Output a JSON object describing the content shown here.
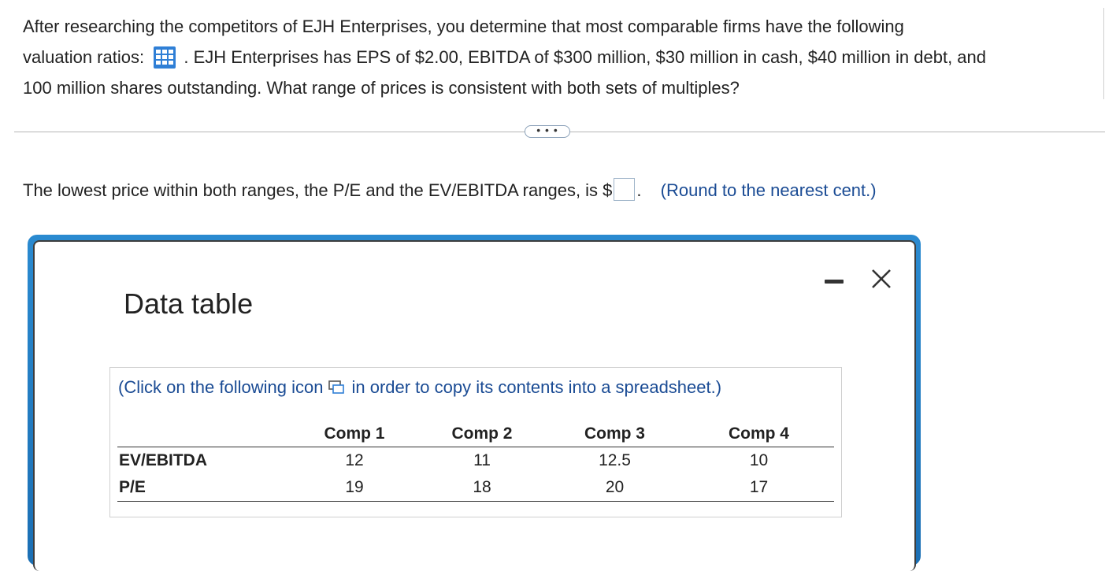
{
  "question": {
    "line1": "After researching the competitors of EJH Enterprises, you determine that most comparable firms have the following",
    "line2_before_icon": "valuation ratios:",
    "line2_after_icon": ". EJH Enterprises has EPS of $2.00, EBITDA of $300 million, $30 million in cash, $40 million in debt, and",
    "line3": "100 million shares outstanding. What range of prices is consistent with both sets of multiples?"
  },
  "more_button": {
    "label": "• • •"
  },
  "answer": {
    "prompt_before": "The lowest price within both ranges, the P/E and the EV/EBITDA ranges, is $",
    "input_value": "",
    "prompt_after": ".",
    "hint": "(Round to the nearest cent.)"
  },
  "modal": {
    "title": "Data table",
    "instruction_before": "(Click on the following icon",
    "instruction_after": "in order to copy its contents into a spreadsheet.)",
    "table": {
      "headers": [
        "",
        "Comp 1",
        "Comp 2",
        "Comp 3",
        "Comp 4"
      ],
      "rows": [
        {
          "label": "EV/EBITDA",
          "values": [
            "12",
            "11",
            "12.5",
            "10"
          ]
        },
        {
          "label": "P/E",
          "values": [
            "19",
            "18",
            "20",
            "17"
          ]
        }
      ]
    }
  },
  "colors": {
    "link_blue": "#1a4b94",
    "modal_frame_blue": "#1b6fb4",
    "grid_icon_blue": "#2f7fd6"
  },
  "icons": {
    "grid": "table-grid-icon",
    "copy": "copy-spreadsheet-icon",
    "minimize": "minimize-icon",
    "close": "close-icon"
  }
}
